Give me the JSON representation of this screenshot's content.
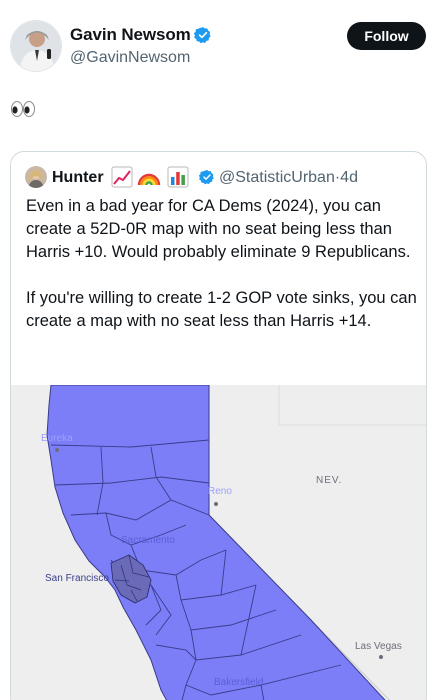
{
  "author": {
    "name": "Gavin Newsom",
    "handle": "@GavinNewsom",
    "verified_icon": "verified-badge-icon"
  },
  "follow_button": {
    "label": "Follow"
  },
  "post": {
    "text": "👀"
  },
  "quoted_post": {
    "author_name": "Hunter",
    "name_emojis": [
      "chart-increasing-icon",
      "rainbow-icon",
      "bar-chart-icon"
    ],
    "handle": "@StatisticUrban",
    "separator": "·",
    "time": "4d",
    "paragraphs": [
      "Even in a bad year for CA Dems (2024), you can create a 52D-0R map with no seat being less than Harris +10. Would probably eliminate 9 Republicans.",
      "If you're willing to create 1-2 GOP vote sinks, you can create a map with no seat less than Harris +14."
    ]
  },
  "map": {
    "labels": {
      "eureka": "Eureka",
      "reno": "Reno",
      "nev": "NEV.",
      "sacramento": "Sacramento",
      "san_francisco": "San Francisco",
      "las_vegas": "Las Vegas",
      "bakersfield": "Bakersfield"
    },
    "colors": {
      "district_fill": "#7b7ef7",
      "district_border": "#3a3c8a",
      "land": "#eeeeee",
      "bay_area_fill": "#6a6ab8"
    }
  }
}
